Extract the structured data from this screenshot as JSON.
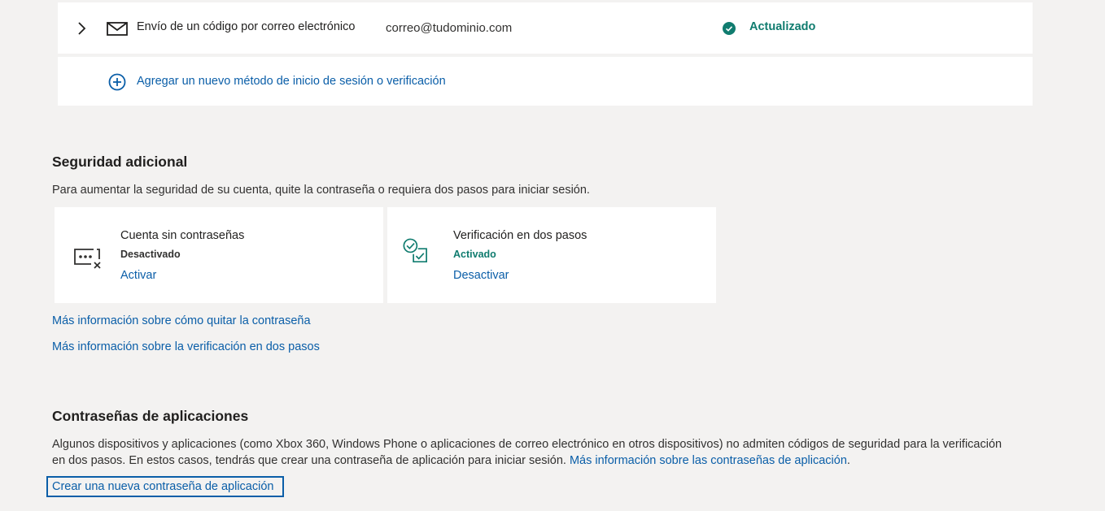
{
  "method": {
    "label": "Envío de un código por correo electrónico",
    "email": "correo@tudominio.com",
    "status": "Actualizado"
  },
  "add_method": {
    "label": "Agregar un nuevo método de inicio de sesión o verificación"
  },
  "additional_security": {
    "title": "Seguridad adicional",
    "description": "Para aumentar la seguridad de su cuenta, quite la contraseña o requiera dos pasos para iniciar sesión.",
    "cards": [
      {
        "title": "Cuenta sin contraseñas",
        "status": "Desactivado",
        "action": "Activar"
      },
      {
        "title": "Verificación en dos pasos",
        "status": "Activado",
        "action": "Desactivar"
      }
    ],
    "links": [
      "Más información sobre cómo quitar la contraseña",
      "Más información sobre la verificación en dos pasos"
    ]
  },
  "app_passwords": {
    "title": "Contraseñas de aplicaciones",
    "description_line1": "Algunos dispositivos y aplicaciones (como Xbox 360, Windows Phone o aplicaciones de correo electrónico en otros dispositivos) no admiten códigos de seguridad para la verificación",
    "description_line2": "en dos pasos. En estos casos, tendrás que crear una contraseña de aplicación para iniciar sesión.",
    "description_link": "Más información sobre las contraseñas de aplicación",
    "description_end": ".",
    "create_button": "Crear una nueva contraseña de aplicación"
  },
  "colors": {
    "link": "#0a5ea8",
    "success": "#107c6f",
    "background": "#f3f2f1",
    "card": "#ffffff"
  }
}
